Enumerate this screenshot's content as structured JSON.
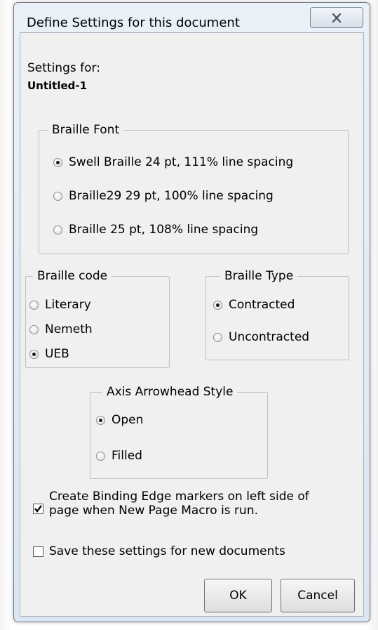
{
  "window": {
    "title": "Define Settings for this document",
    "close_glyph": "close-icon"
  },
  "settings_for": {
    "label": "Settings for:",
    "document_name": "Untitled-1"
  },
  "braille_font": {
    "legend": "Braille Font",
    "options": [
      {
        "label": "Swell Braille 24 pt, 111% line spacing",
        "selected": true
      },
      {
        "label": "Braille29 29 pt, 100% line spacing",
        "selected": false
      },
      {
        "label": "Braille 25 pt, 108% line spacing",
        "selected": false
      }
    ]
  },
  "braille_code": {
    "legend": "Braille code",
    "options": [
      {
        "label": "Literary",
        "selected": false
      },
      {
        "label": "Nemeth",
        "selected": false
      },
      {
        "label": "UEB",
        "selected": true
      }
    ]
  },
  "braille_type": {
    "legend": "Braille Type",
    "options": [
      {
        "label": "Contracted",
        "selected": true
      },
      {
        "label": "Uncontracted",
        "selected": false
      }
    ]
  },
  "arrowhead": {
    "legend": "Axis Arrowhead Style",
    "options": [
      {
        "label": "Open",
        "selected": true
      },
      {
        "label": "Filled",
        "selected": false
      }
    ]
  },
  "binding_edge": {
    "line1": "Create Binding Edge markers on left side of",
    "line2": "page when New Page Macro is run.",
    "checked": true
  },
  "save_settings": {
    "label": "Save these settings for new documents",
    "checked": false
  },
  "buttons": {
    "ok": "OK",
    "cancel": "Cancel"
  }
}
